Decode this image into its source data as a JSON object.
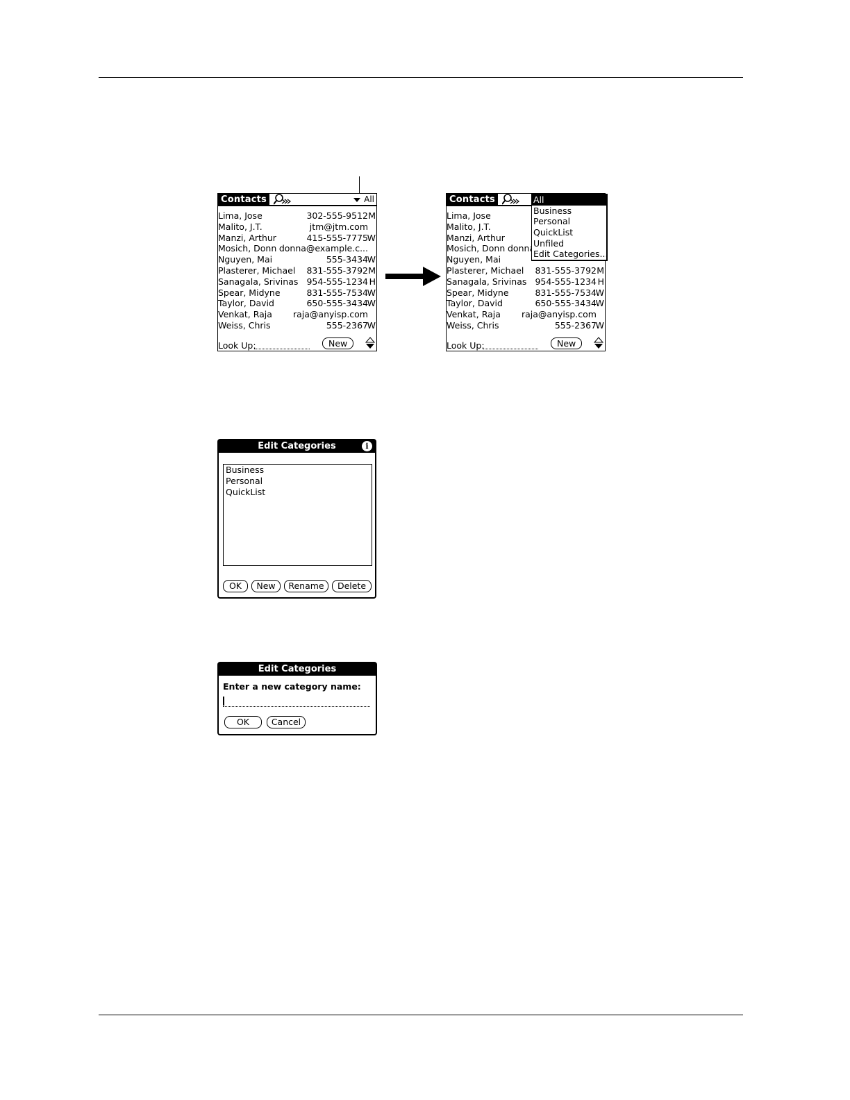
{
  "contacts_screen": {
    "title": "Contacts",
    "category": "All",
    "rows": [
      {
        "name": "Lima, Jose",
        "value": "302-555-9512",
        "type": "M"
      },
      {
        "name": "Malito, J.T.",
        "value": "jtm@jtm.com",
        "type": ""
      },
      {
        "name": "Manzi, Arthur",
        "value": "415-555-7775",
        "type": "W"
      },
      {
        "name": "Mosich, Donn",
        "value": "donna@example.c...",
        "type": ""
      },
      {
        "name": "Nguyen, Mai",
        "value": "555-3434",
        "type": "W"
      },
      {
        "name": "Plasterer, Michael",
        "value": "831-555-3792",
        "type": "M"
      },
      {
        "name": "Sanagala, Srivinas",
        "value": "954-555-1234",
        "type": "H"
      },
      {
        "name": "Spear, Midyne",
        "value": "831-555-7534",
        "type": "W"
      },
      {
        "name": "Taylor, David",
        "value": "650-555-3434",
        "type": "W"
      },
      {
        "name": "Venkat, Raja",
        "value": "raja@anyisp.com",
        "type": ""
      },
      {
        "name": "Weiss, Chris",
        "value": "555-2367",
        "type": "W"
      }
    ],
    "lookup_label": "Look Up:",
    "new_label": "New"
  },
  "contacts_screen_menu": {
    "title": "Contacts",
    "rows": [
      {
        "name": "Lima, Jose",
        "value": "",
        "type": ""
      },
      {
        "name": "Malito, J.T.",
        "value": "",
        "type": ""
      },
      {
        "name": "Manzi, Arthur",
        "value": "",
        "type": ""
      },
      {
        "name": "Mosich, Donn",
        "value": "donna",
        "type": ""
      },
      {
        "name": "Nguyen, Mai",
        "value": "",
        "type": ""
      },
      {
        "name": "Plasterer, Michael",
        "value": "831-555-3792",
        "type": "M"
      },
      {
        "name": "Sanagala, Srivinas",
        "value": "954-555-1234",
        "type": "H"
      },
      {
        "name": "Spear, Midyne",
        "value": "831-555-7534",
        "type": "W"
      },
      {
        "name": "Taylor, David",
        "value": "650-555-3434",
        "type": "W"
      },
      {
        "name": "Venkat, Raja",
        "value": "raja@anyisp.com",
        "type": ""
      },
      {
        "name": "Weiss, Chris",
        "value": "555-2367",
        "type": "W"
      }
    ],
    "menu_items": [
      "All",
      "Business",
      "Personal",
      "QuickList",
      "Unfiled",
      "Edit Categories..."
    ],
    "lookup_label": "Look Up:",
    "new_label": "New"
  },
  "edit_categories": {
    "title": "Edit Categories",
    "info_icon": "i",
    "items": [
      "Business",
      "Personal",
      "QuickList"
    ],
    "buttons": {
      "ok": "OK",
      "new": "New",
      "rename": "Rename",
      "delete": "Delete"
    }
  },
  "new_category": {
    "title": "Edit Categories",
    "prompt": "Enter a new category name:",
    "input_value": "",
    "buttons": {
      "ok": "OK",
      "cancel": "Cancel"
    }
  }
}
